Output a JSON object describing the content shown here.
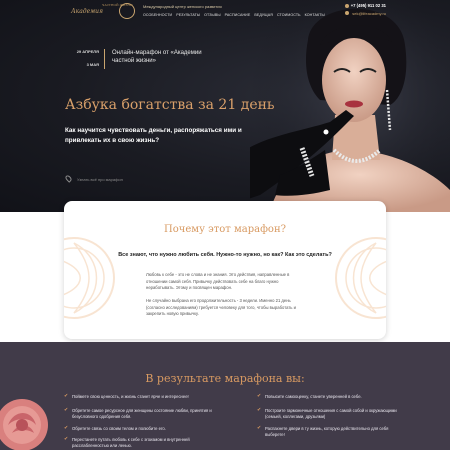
{
  "nav": {
    "logo": "Академия",
    "logo_sub": "ЧАСТНОЙ ЖИЗНИ",
    "tagline": "Международный центр женского развития",
    "links": [
      "ОСОБЕННОСТИ",
      "РЕЗУЛЬТАТЫ",
      "ОТЗЫВЫ",
      "РАСПИСАНИЕ",
      "ВЕДУЩАЯ",
      "СТОИМОСТЬ",
      "КОНТАКТЫ"
    ],
    "phone": "+7 (495) 911 02 31",
    "email": "sek@lifeacadmy.ru"
  },
  "hero": {
    "date_start": "29 АПРЕЛЯ",
    "date_end": "3 МАЯ",
    "event_title": "Онлайн-марафон от «Академии частной жизни»",
    "headline": "Азбука богатства за 21 день",
    "question": "Как научится чувствовать деньги, распоряжаться ими и привлекать их в свою жизнь?",
    "place_link": "Узнать всё про марафон"
  },
  "why": {
    "title": "Почему этот марафон?",
    "lead": "Все знают, что нужно любить себя. Нужно-то нужно, но как? Как это сделать?",
    "p1": "Любовь к себе - это не слова и не знания. Это действия, направленные в отношении самой себя. Привычку действовать себе на благо нужно неработывать. Этому и посвящен марафон.",
    "p2": "Не случайно выбрана его продолжительность - 3 недели. Именно 21 день (согласно исследованиям) требуется человеку для того, чтобы выработать и закрепить новую привычку."
  },
  "results": {
    "title": "В результате марафона вы:",
    "left": [
      "Поймете свою ценность, и жизнь станет ярче и интереснее!",
      "Обретете самое ресурсное для женщины состояние любви, принятия и безусловного одобрения себя.",
      "Обретете связь со своим телом и полюбите его.",
      "Перестанете путать любовь к себе с эгоизмом и внутренней расслабленностью или ленью."
    ],
    "right": [
      "Повысите самооценку, станете уверенней в себе.",
      "Построите гармоничные отношения с самой собой и окружающими (семьей, коллегами, друзьями)",
      "Распахнете двери в ту жизнь, которую действительно для себя выберете!"
    ]
  },
  "colors": {
    "accent": "#d89a62",
    "hero_bg": "#1a1b22",
    "results_bg": "#413b49"
  }
}
